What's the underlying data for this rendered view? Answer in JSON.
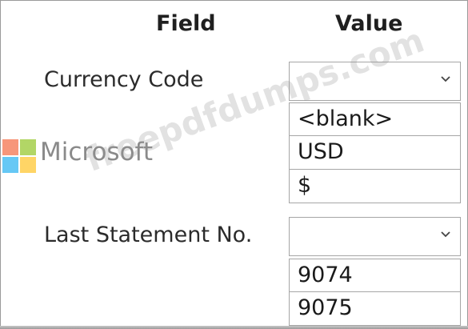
{
  "headers": {
    "field": "Field",
    "value": "Value"
  },
  "rows": [
    {
      "label": "Currency Code",
      "dropdown_value": "",
      "options": [
        "<blank>",
        "USD",
        "$"
      ]
    },
    {
      "label": "Last Statement No.",
      "dropdown_value": "",
      "options": [
        "9074",
        "9075"
      ]
    }
  ],
  "branding": {
    "logo_text": "Microsoft"
  },
  "watermark": {
    "text": "freepdfdumps.com"
  },
  "icons": {
    "dropdown": "chevron-down-icon"
  }
}
